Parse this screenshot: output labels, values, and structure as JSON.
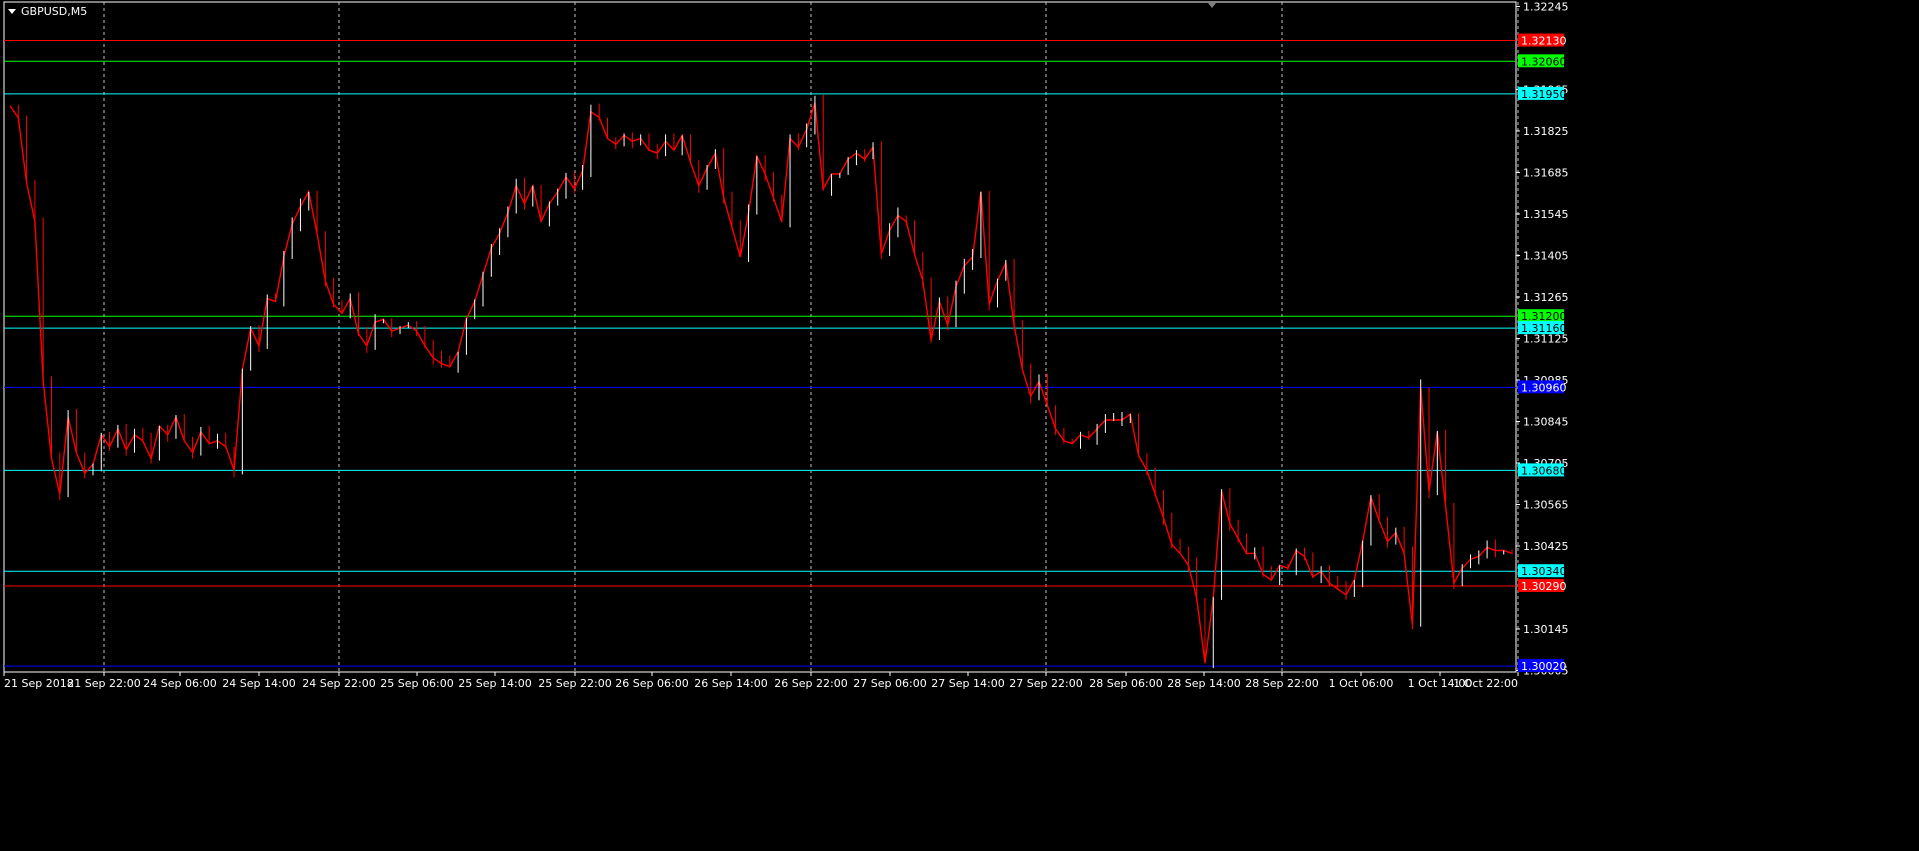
{
  "window": {
    "symbol_title": "GBPUSD,M5"
  },
  "colors": {
    "background": "#000000",
    "axis": "#ffffff",
    "grid": "#c0c0c0",
    "bull_candle": "#ffffff",
    "bear_candle": "#ff0000",
    "line_red": "#ff0000",
    "line_green": "#00ff00",
    "line_aqua": "#00ffff",
    "line_blue": "#0000ff"
  },
  "chart_data": {
    "type": "line",
    "symbol": "GBPUSD",
    "timeframe": "M5",
    "grid": true,
    "ylim": [
      1.3,
      1.3226
    ],
    "y_ticks": [
      "1.32245",
      "1.31965",
      "1.31825",
      "1.31685",
      "1.31545",
      "1.31405",
      "1.31265",
      "1.31125",
      "1.30985",
      "1.30845",
      "1.30705",
      "1.30565",
      "1.30425",
      "1.30145",
      "1.30005"
    ],
    "x_ticks": [
      "21 Sep 2018",
      "21 Sep 22:00",
      "24 Sep 06:00",
      "24 Sep 14:00",
      "24 Sep 22:00",
      "25 Sep 06:00",
      "25 Sep 14:00",
      "25 Sep 22:00",
      "26 Sep 06:00",
      "26 Sep 14:00",
      "26 Sep 22:00",
      "27 Sep 06:00",
      "27 Sep 14:00",
      "27 Sep 22:00",
      "28 Sep 06:00",
      "28 Sep 14:00",
      "28 Sep 22:00",
      "1 Oct 06:00",
      "1 Oct 14:00",
      "1 Oct 22:00"
    ],
    "levels": [
      {
        "price": 1.3213,
        "label": "1.32130",
        "color": "#ff0000",
        "text_color": "#ffffff"
      },
      {
        "price": 1.3206,
        "label": "1.32060",
        "color": "#00ff00",
        "text_color": "#000000"
      },
      {
        "price": 1.3195,
        "label": "1.31950",
        "color": "#00ffff",
        "text_color": "#000000"
      },
      {
        "price": 1.312,
        "label": "1.31200",
        "color": "#00ff00",
        "text_color": "#000000"
      },
      {
        "price": 1.3116,
        "label": "1.31160",
        "color": "#00ffff",
        "text_color": "#000000"
      },
      {
        "price": 1.3096,
        "label": "1.30960",
        "color": "#0000ff",
        "text_color": "#ffffff"
      },
      {
        "price": 1.3068,
        "label": "1.30680",
        "color": "#00ffff",
        "text_color": "#000000"
      },
      {
        "price": 1.3034,
        "label": "1.30340",
        "color": "#00ffff",
        "text_color": "#000000"
      },
      {
        "price": 1.3029,
        "label": "1.30290",
        "color": "#ff0000",
        "text_color": "#ffffff"
      },
      {
        "price": 1.3002,
        "label": "1.30020",
        "color": "#0000ff",
        "text_color": "#ffffff"
      }
    ],
    "series": [
      {
        "color": "#ff0000",
        "values": [
          1.3191,
          1.3187,
          1.3165,
          1.3152,
          1.3098,
          1.3072,
          1.306,
          1.3086,
          1.3074,
          1.3067,
          1.307,
          1.308,
          1.3076,
          1.3082,
          1.3075,
          1.308,
          1.3078,
          1.3072,
          1.3083,
          1.308,
          1.3086,
          1.3078,
          1.3074,
          1.3081,
          1.3077,
          1.3078,
          1.3076,
          1.3068,
          1.3102,
          1.3116,
          1.311,
          1.3126,
          1.3125,
          1.314,
          1.3151,
          1.3157,
          1.3162,
          1.3148,
          1.3132,
          1.3124,
          1.3121,
          1.3126,
          1.3114,
          1.311,
          1.3118,
          1.3119,
          1.3115,
          1.3116,
          1.3117,
          1.3115,
          1.311,
          1.3106,
          1.3104,
          1.3103,
          1.3108,
          1.3119,
          1.3125,
          1.3134,
          1.3143,
          1.3148,
          1.3155,
          1.3164,
          1.3158,
          1.3164,
          1.3152,
          1.3158,
          1.3162,
          1.3167,
          1.3163,
          1.3169,
          1.3189,
          1.3187,
          1.318,
          1.3178,
          1.3181,
          1.3179,
          1.318,
          1.3176,
          1.3175,
          1.3179,
          1.3176,
          1.3181,
          1.3172,
          1.3164,
          1.317,
          1.3175,
          1.316,
          1.315,
          1.314,
          1.3155,
          1.3174,
          1.3168,
          1.316,
          1.3152,
          1.318,
          1.3177,
          1.3183,
          1.3192,
          1.3163,
          1.3168,
          1.3168,
          1.3173,
          1.3175,
          1.3173,
          1.3177,
          1.3141,
          1.3149,
          1.3154,
          1.3152,
          1.3141,
          1.3132,
          1.3112,
          1.3125,
          1.3117,
          1.313,
          1.3137,
          1.314,
          1.3162,
          1.3124,
          1.3132,
          1.3138,
          1.3117,
          1.3102,
          1.3093,
          1.3098,
          1.309,
          1.3082,
          1.3078,
          1.3077,
          1.308,
          1.3079,
          1.3082,
          1.3085,
          1.3085,
          1.3085,
          1.3087,
          1.3073,
          1.3068,
          1.306,
          1.3052,
          1.3043,
          1.304,
          1.3036,
          1.3025,
          1.3003,
          1.3025,
          1.3061,
          1.305,
          1.3045,
          1.304,
          1.304,
          1.3033,
          1.3031,
          1.3036,
          1.3035,
          1.3041,
          1.3039,
          1.3032,
          1.3034,
          1.303,
          1.3028,
          1.3026,
          1.3031,
          1.3044,
          1.3059,
          1.3051,
          1.3044,
          1.3047,
          1.304,
          1.3016,
          1.3096,
          1.3061,
          1.3081,
          1.3056,
          1.303,
          1.3035,
          1.3038,
          1.3039,
          1.3042,
          1.3041,
          1.3041,
          1.304
        ]
      }
    ]
  }
}
